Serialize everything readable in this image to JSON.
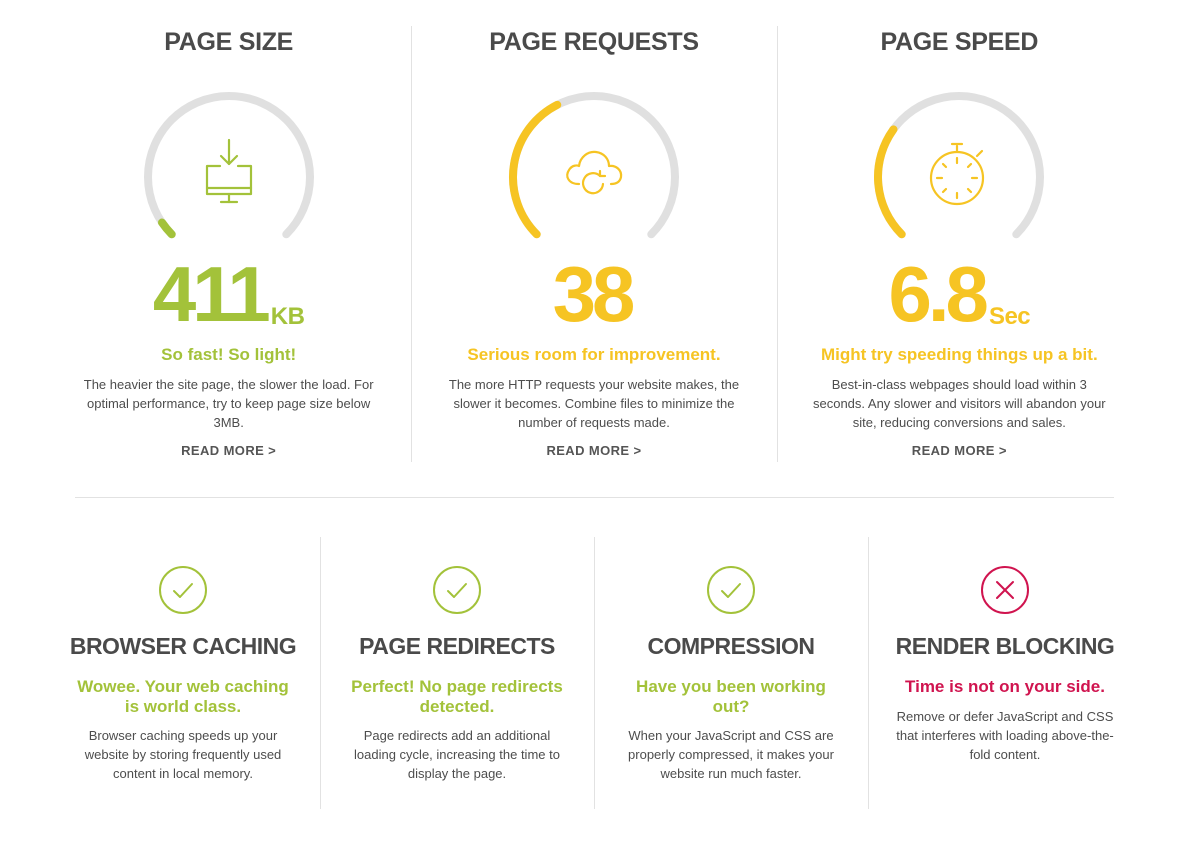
{
  "colors": {
    "green": "#a3c23a",
    "yellow": "#f6c423",
    "red": "#d0144f",
    "track": "#e0e0e0"
  },
  "metrics": [
    {
      "title": "PAGE SIZE",
      "icon": "download-monitor-icon",
      "value": "411",
      "unit": "KB",
      "color": "#a3c23a",
      "gauge_fraction": 0.04,
      "headline": "So fast! So light!",
      "description": "The heavier the site page, the slower the load. For optimal performance, try to keep page size below 3MB.",
      "link": "READ MORE >"
    },
    {
      "title": "PAGE REQUESTS",
      "icon": "cloud-sync-icon",
      "value": "38",
      "unit": "",
      "color": "#f6c423",
      "gauge_fraction": 0.4,
      "headline": "Serious room for improvement.",
      "description": "The more HTTP requests your website makes, the slower it becomes. Combine files to minimize the number of requests made.",
      "link": "READ MORE >"
    },
    {
      "title": "PAGE SPEED",
      "icon": "stopwatch-icon",
      "value": "6.8",
      "unit": "Sec",
      "color": "#f6c423",
      "gauge_fraction": 0.3,
      "headline": "Might try speeding things up a bit.",
      "description": "Best-in-class webpages should load within 3 seconds. Any slower and visitors will abandon your site, reducing conversions and sales.",
      "link": "READ MORE >"
    }
  ],
  "checks": [
    {
      "title": "BROWSER CACHING",
      "status": "pass",
      "icon": "check-circle-icon",
      "color": "#a3c23a",
      "headline": "Wowee. Your web caching is world class.",
      "description": "Browser caching speeds up your website by storing frequently used content in local memory."
    },
    {
      "title": "PAGE REDIRECTS",
      "status": "pass",
      "icon": "check-circle-icon",
      "color": "#a3c23a",
      "headline": "Perfect! No page redirects detected.",
      "description": "Page redirects add an additional loading cycle, increasing the time to display the page."
    },
    {
      "title": "COMPRESSION",
      "status": "pass",
      "icon": "check-circle-icon",
      "color": "#a3c23a",
      "headline": "Have you been working out?",
      "description": "When your JavaScript and CSS are properly compressed, it makes your website run much faster."
    },
    {
      "title": "RENDER BLOCKING",
      "status": "fail",
      "icon": "x-circle-icon",
      "color": "#d0144f",
      "headline": "Time is not on your side.",
      "description": "Remove or defer JavaScript and CSS that interferes with loading above-the-fold content."
    }
  ]
}
